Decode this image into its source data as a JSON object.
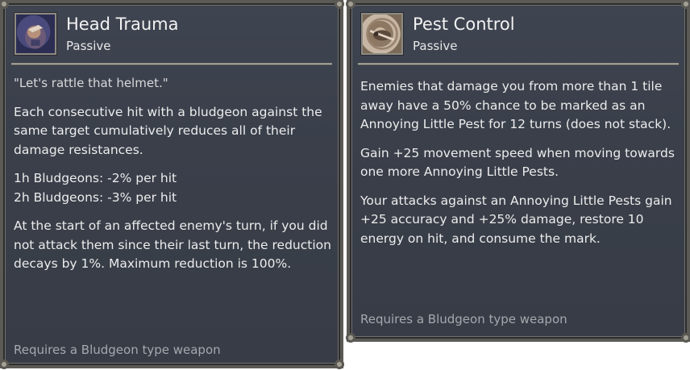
{
  "tooltips": [
    {
      "title": "Head Trauma",
      "subtitle": "Passive",
      "icon": "head-trauma-icon",
      "quote": "\"Let's rattle that helmet.\"",
      "paragraphs": [
        "Each consecutive hit with a bludgeon against the same target cumulatively reduces all of their damage resistances.",
        "1h Bludgeons: -2% per hit",
        "2h Bludgeons: -3% per hit",
        "At the start of an affected enemy's turn, if you did not attack them since their last turn, the reduction decays by 1%. Maximum reduction is 100%."
      ],
      "requirement": "Requires a Bludgeon type weapon"
    },
    {
      "title": "Pest Control",
      "subtitle": "Passive",
      "icon": "pest-control-icon",
      "paragraphs": [
        "Enemies that damage you from more than 1 tile away have a 50% chance to be marked as an Annoying Little Pest for 12 turns (does not stack).",
        "Gain +25 movement speed when moving towards one more Annoying Little Pests.",
        "Your attacks against an Annoying Little Pests gain +25 accuracy and +25% damage, restore 10 energy on hit, and consume the mark."
      ],
      "requirement": "Requires a Bludgeon type weapon"
    }
  ]
}
